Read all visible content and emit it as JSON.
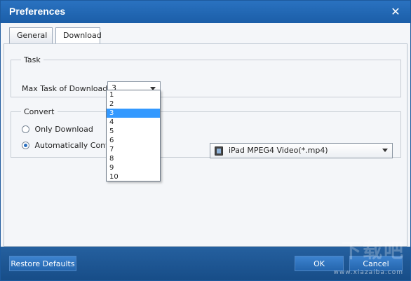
{
  "window": {
    "title": "Preferences",
    "close_symbol": "✕"
  },
  "tabs": [
    {
      "label": "General",
      "active": false
    },
    {
      "label": "Download",
      "active": true
    }
  ],
  "task": {
    "legend": "Task",
    "max_label": "Max Task of Download:",
    "max_value": "3",
    "options": [
      "1",
      "2",
      "3",
      "4",
      "5",
      "6",
      "7",
      "8",
      "9",
      "10"
    ],
    "selected_option": "3"
  },
  "convert": {
    "legend": "Convert",
    "only_download_label": "Only Download",
    "auto_convert_label": "Automatically Convert",
    "selected": "auto_convert",
    "format_value": "iPad MPEG4 Video(*.mp4)"
  },
  "buttons": {
    "restore": "Restore Defaults",
    "ok": "OK",
    "cancel": "Cancel"
  },
  "watermark": {
    "logo": "下载吧",
    "url": "www.xiazaiba.com"
  },
  "colors": {
    "accent": "#1b5ea8",
    "selection": "#3399ff"
  }
}
